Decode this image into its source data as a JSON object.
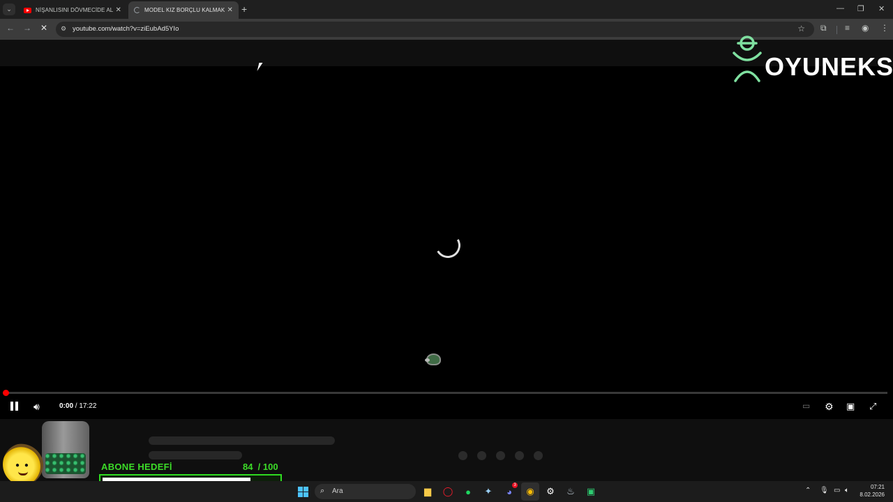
{
  "browser": {
    "tabs": [
      {
        "title": "NİŞANLISINI DÖVMECİDE ALDA",
        "active": false
      },
      {
        "title": "MODEL KIZ BORÇLU KALMAK İ",
        "active": true
      }
    ],
    "url": "youtube.com/watch?v=ziEubAd5YIo"
  },
  "player": {
    "current_time": "0:00",
    "duration": "/ 17:22",
    "progress": 0.0
  },
  "overlay": {
    "logo_text": "OYUNEKS",
    "goal_title": "ABONE HEDEFİ",
    "goal_count": "84  / 100",
    "goal_current": 84,
    "goal_target": 100,
    "goal_color": "#3cdc28"
  },
  "taskbar": {
    "search_label": "Ara",
    "time": "07:21",
    "date": "8.02.2026",
    "discord_badge": "3"
  }
}
